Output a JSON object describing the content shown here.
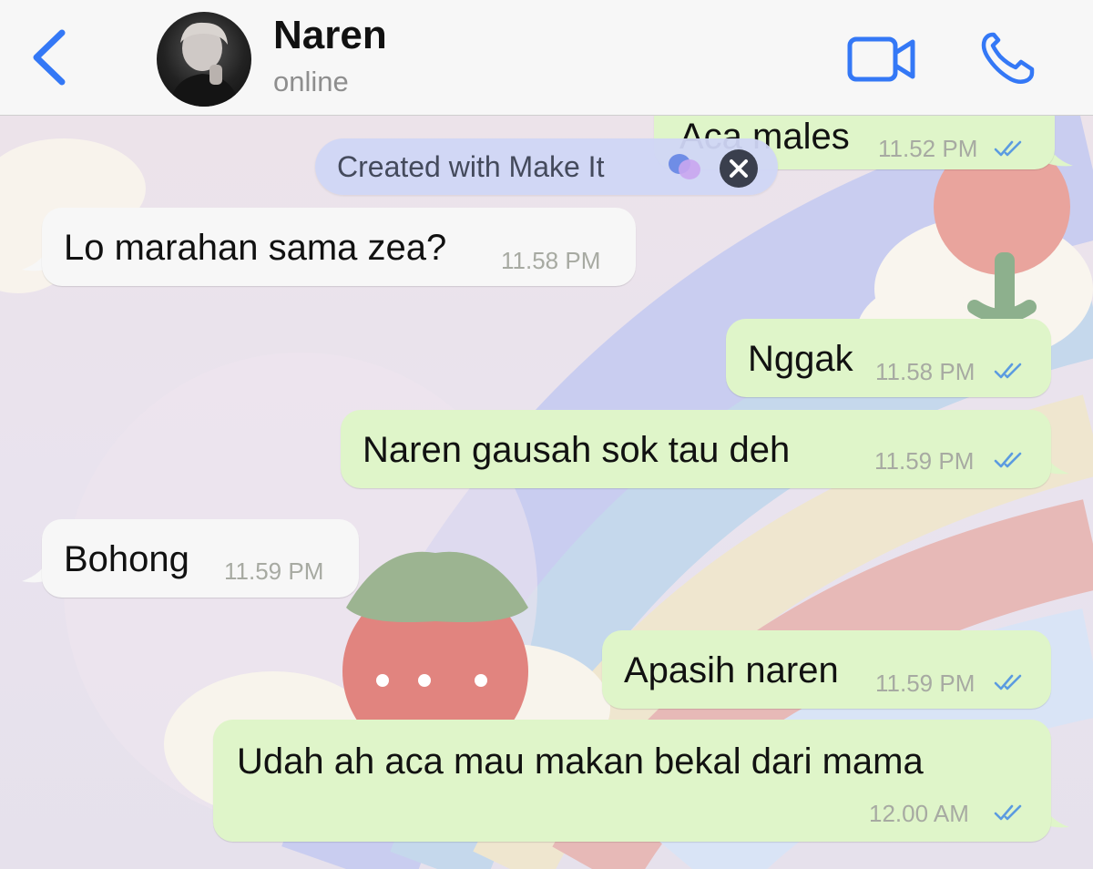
{
  "header": {
    "contact_name": "Naren",
    "status": "online"
  },
  "watermark": {
    "text": "Created with Make It"
  },
  "messages": [
    {
      "direction": "outgoing",
      "text": "Aca males",
      "time": "11.52 PM",
      "read": true
    },
    {
      "direction": "incoming",
      "text": "Lo marahan sama zea?",
      "time": "11.58 PM"
    },
    {
      "direction": "outgoing",
      "text": "Nggak",
      "time": "11.58 PM",
      "read": true
    },
    {
      "direction": "outgoing",
      "text": "Naren gausah sok tau deh",
      "time": "11.59 PM",
      "read": true
    },
    {
      "direction": "incoming",
      "text": "Bohong",
      "time": "11.59 PM"
    },
    {
      "direction": "outgoing",
      "text": "Apasih naren",
      "time": "11.59 PM",
      "read": true
    },
    {
      "direction": "outgoing",
      "text": "Udah ah aca mau makan bekal dari mama",
      "time": "12.00 AM",
      "read": true
    }
  ],
  "colors": {
    "accent": "#3478f6",
    "incoming_bubble": "#f7f7f7",
    "outgoing_bubble": "#dff5c9",
    "read_ticks": "#5b9be0"
  },
  "icons": {
    "back": "chevron-left-icon",
    "video": "video-camera-icon",
    "call": "phone-icon",
    "read_receipt": "double-check-icon",
    "close": "close-icon"
  }
}
